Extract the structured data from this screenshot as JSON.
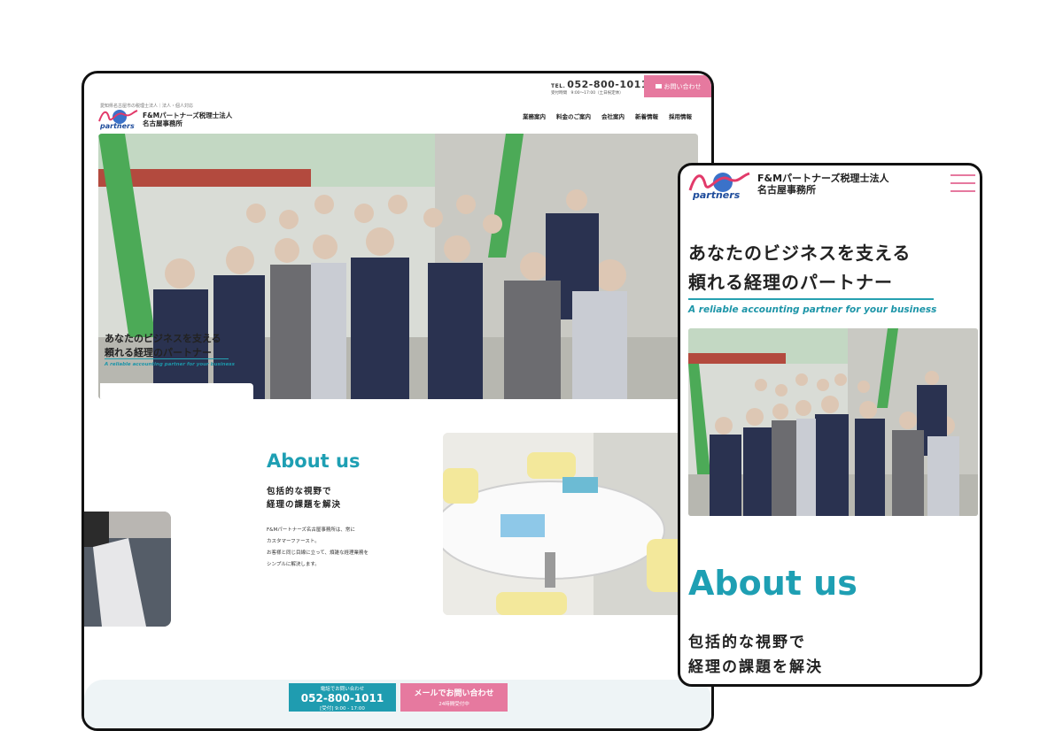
{
  "desktop": {
    "top_bar": {
      "tel_prefix": "TEL.",
      "tel_number": "052-800-1011",
      "hours": "受付時間　9:00～17:00（土日祝定休）",
      "contact_button": "お問い合わせ"
    },
    "header": {
      "small_line": "愛知県名古屋市の税理士法人｜法人・個人対応",
      "brand_line1": "F&Mパートナーズ税理士法人",
      "brand_line2": "名古屋事務所",
      "nav": [
        "業務案内",
        "料金のご案内",
        "会社案内",
        "新着情報",
        "採用情報"
      ]
    },
    "hero": {
      "tagline_line1": "あなたのビジネスを支える",
      "tagline_line2": "頼れる経理のパートナー",
      "tagline_en": "A reliable accounting partner for your business"
    },
    "about": {
      "title": "About us",
      "subtitle_line1": "包括的な視野で",
      "subtitle_line2": "経理の課題を解決",
      "body": [
        "F&Mパートナーズ名古屋事務所は、常に",
        "カスタマーファースト。",
        "お客様と同じ目線に立って、煩雑な経理業務を",
        "シンプルに解決します。"
      ]
    },
    "footer": {
      "phone_small": "電話でお問い合わせ",
      "phone_number": "052-800-1011",
      "phone_hours": "[受付] 9:00 - 17:00",
      "mail_main": "メールでお問い合わせ",
      "mail_small": "24時間受付中"
    }
  },
  "mobile": {
    "logo_text": "partners",
    "brand_line1": "F&Mパートナーズ税理士法人",
    "brand_line2": "名古屋事務所",
    "tagline_line1": "あなたのビジネスを支える",
    "tagline_line2": "頼れる経理のパートナー",
    "tagline_en": "A reliable accounting partner for your business",
    "about_title": "About us",
    "about_sub1": "包括的な視野で",
    "about_sub2": "経理の課題を解決"
  },
  "colors": {
    "accent_teal": "#1e9fb3",
    "accent_pink": "#e6799f",
    "text": "#222222"
  },
  "icons": [
    "logo-mark-icon",
    "mail-icon",
    "hamburger-menu-icon"
  ]
}
